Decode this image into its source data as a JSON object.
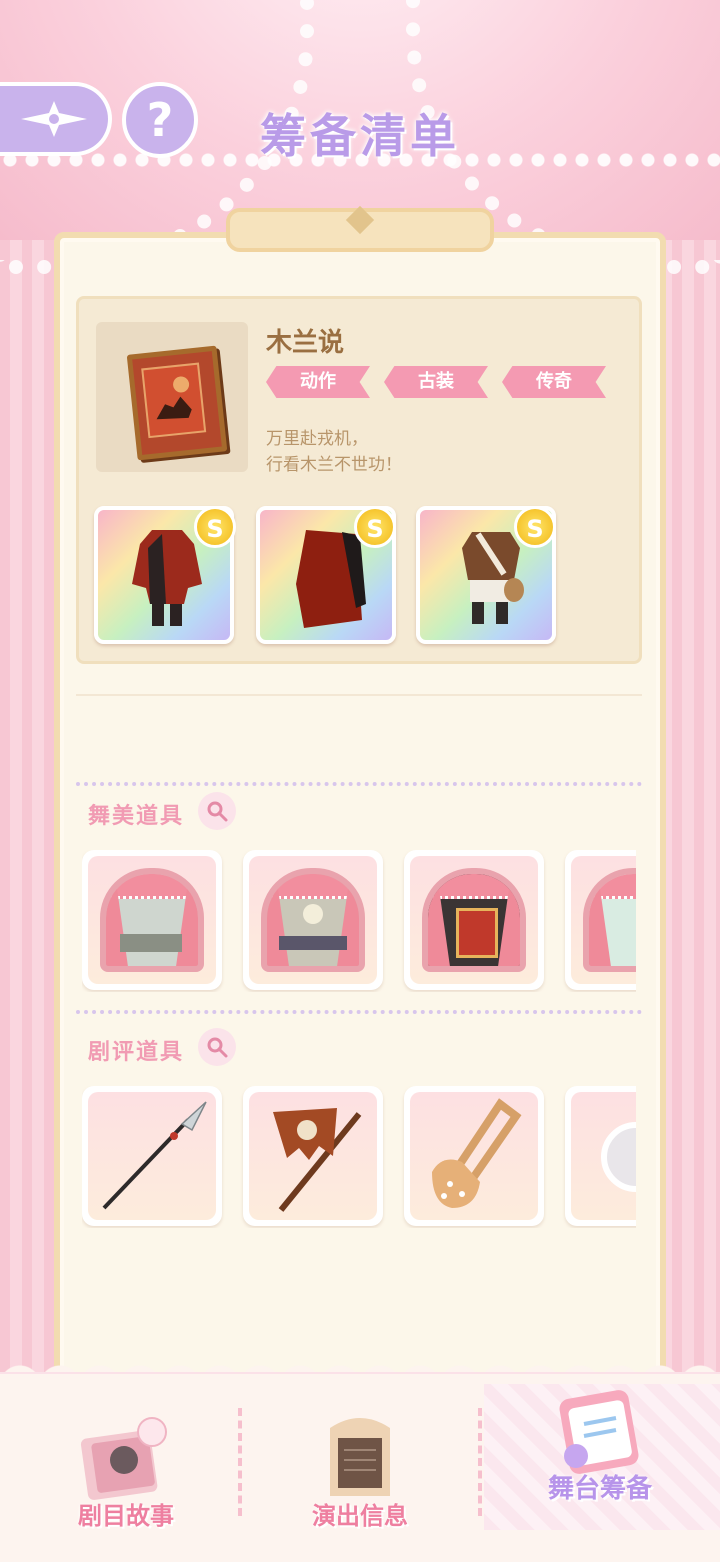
{
  "header": {
    "title": "筹备清单",
    "help_symbol": "?"
  },
  "drama": {
    "name": "木兰说",
    "tags": [
      "动作",
      "古装",
      "传奇"
    ],
    "description": "万里赴戎机，\n行看木兰不世功！",
    "outfit_badge": "S"
  },
  "sections": {
    "stage_props": {
      "title": "舞美道具"
    },
    "review_props": {
      "title": "剧评道具"
    }
  },
  "bottom_tabs": [
    {
      "label": "剧目故事"
    },
    {
      "label": "演出信息"
    },
    {
      "label": "舞台筹备"
    }
  ],
  "colors": {
    "title_purple": "#b99be8",
    "tag_pink": "#f49ab2",
    "section_pink": "#f19bb3",
    "tab_pink": "#ee7fa0",
    "tab_active_purple": "#b794ea"
  },
  "icons": {
    "back": "compass-back-icon",
    "help": "question-icon",
    "search": "magnifier-icon",
    "stories": "storybook-icon",
    "info": "info-board-icon",
    "prepare": "clipboard-icon"
  }
}
